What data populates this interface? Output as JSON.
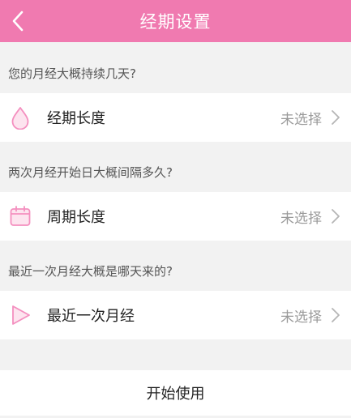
{
  "header": {
    "title": "经期设置",
    "back_icon": "chevron-left-icon"
  },
  "sections": [
    {
      "question": "您的月经大概持续几天?",
      "item_label": "经期长度",
      "item_value": "未选择",
      "icon": "drop-icon"
    },
    {
      "question": "两次月经开始日大概间隔多久?",
      "item_label": "周期长度",
      "item_value": "未选择",
      "icon": "calendar-icon"
    },
    {
      "question": "最近一次月经大概是哪天来的?",
      "item_label": "最近一次月经",
      "item_value": "未选择",
      "icon": "play-icon"
    }
  ],
  "start_button": {
    "label": "开始使用"
  },
  "colors": {
    "accent": "#f07ab0",
    "icon_pink": "#f48fbf",
    "background": "#f2f2f2"
  }
}
